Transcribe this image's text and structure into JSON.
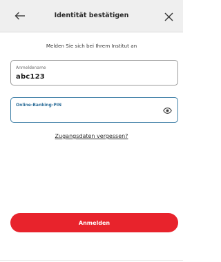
{
  "header": {
    "title": "Identität bestätigen",
    "back_icon": "arrow-left-icon",
    "close_icon": "close-icon"
  },
  "subtitle": "Melden Sie sich bei Ihrem Institut an",
  "username_field": {
    "label": "Anmeldename",
    "value": "abc123"
  },
  "pin_field": {
    "label": "Online-Banking-PIN",
    "value": "",
    "toggle_icon": "eye-icon"
  },
  "forgot_link": "Zugangsdaten vergessen?",
  "login_button": "Anmelden",
  "colors": {
    "primary": "#e8232c",
    "focus_border": "#3d7ea6",
    "header_bg": "#efefef"
  }
}
